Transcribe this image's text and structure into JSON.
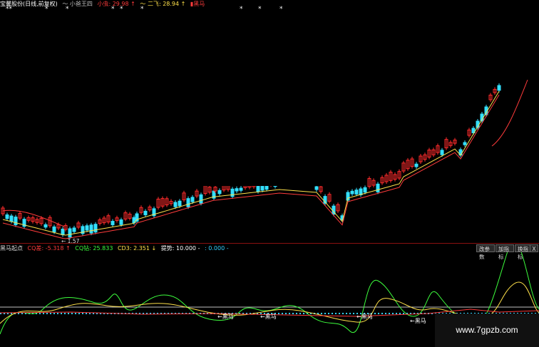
{
  "header": {
    "stock_name": "宝馨股份(日线,前复权)",
    "item1_name": "小爸王四",
    "item2_label": "小虫",
    "item2_value": "29.98",
    "item2_arrow": "↑",
    "item3_label": "二飞",
    "item3_value": "28.94",
    "item3_arrow": "↑",
    "item4_label": "黑马",
    "colors": {
      "red": "#ff3b3b",
      "yellow": "#ffe14a",
      "white": "#ffffff"
    }
  },
  "stars": [
    "**",
    "*",
    "*",
    "*",
    "*",
    "*",
    "*",
    "*",
    "*"
  ],
  "main_chart": {
    "low_price_label": "1.57",
    "marker_red": "#ff2b2b",
    "marker_cyan": "#33e0ff"
  },
  "indicator": {
    "name": "黑马起点",
    "cq_label": "CQ差",
    "cq_value": "-5.318",
    "cq_arrow": "↑",
    "cq2_label": "CQ钻",
    "cq2_value": "25.833",
    "cd3_label": "CD3",
    "cd3_value": "2.351",
    "cd3_arrow": "↓",
    "tip_label": "提势",
    "tip_value": "10.000",
    "tip_sep": "-",
    "zero_label": ":",
    "zero_value": "0.000",
    "zero_sep": "-",
    "signal_text": "黑马",
    "buttons": {
      "params": "改参数",
      "add": "加指标",
      "switch": "换指标",
      "close": "X"
    }
  },
  "watermark": "www.7gpzb.com"
}
